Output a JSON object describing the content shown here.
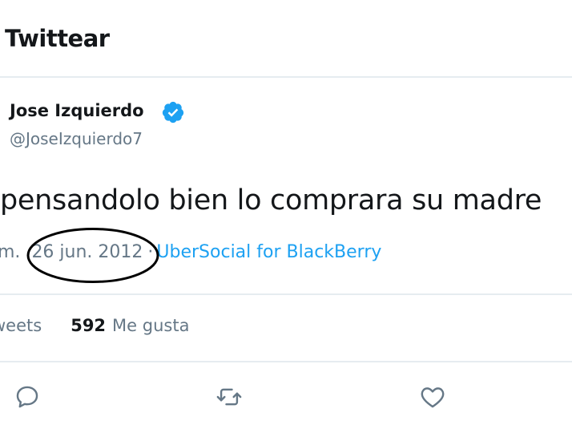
{
  "header": {
    "title": "Twittear"
  },
  "tweet": {
    "author_name": "Jose Izquierdo",
    "author_handle": "@JoseIzquierdo7",
    "verified": true,
    "text": "pensandolo bien lo comprara su madre",
    "time_partial": "m.",
    "date": "26 jun. 2012",
    "separator": "·",
    "source": "UberSocial for BlackBerry"
  },
  "stats": {
    "retweets_label_partial": "weets",
    "likes_count": "592",
    "likes_label": "Me gusta"
  },
  "actions": {
    "icons": [
      "reply-icon",
      "retweet-icon",
      "like-icon"
    ]
  },
  "colors": {
    "link": "#1da1f2",
    "secondary_text": "#657786",
    "primary_text": "#14171a",
    "divider": "#e6ecf0",
    "annotation": "#000000"
  }
}
